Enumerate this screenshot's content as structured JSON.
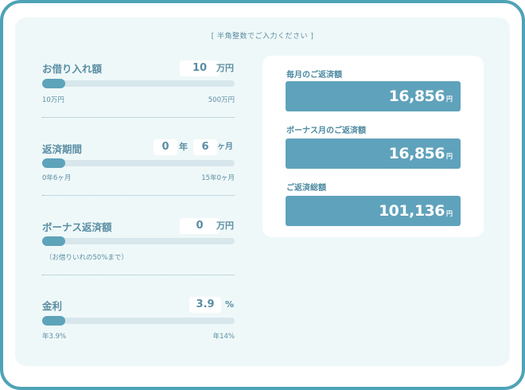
{
  "note": "[ 半角整数でご入力ください ]",
  "loan": {
    "label": "お借り入れ額",
    "value": "10",
    "unit": "万円",
    "min": "10万円",
    "max": "500万円",
    "fill": 0
  },
  "period": {
    "label": "返済期間",
    "years": "0",
    "year_unit": "年",
    "months": "6",
    "month_unit": "ヶ月",
    "min": "0年6ヶ月",
    "max": "15年0ヶ月",
    "fill": 0
  },
  "bonus": {
    "label": "ボーナス返済額",
    "value": "0",
    "unit": "万円",
    "note": "（お借りいれの50%まで）",
    "fill": 0
  },
  "rate": {
    "label": "金利",
    "value": "3.9",
    "unit": "%",
    "min": "年3.9%",
    "max": "年14%",
    "fill": 0
  },
  "results": {
    "monthly": {
      "label": "毎月のご返済額",
      "value": "16,856",
      "unit": "円"
    },
    "bonus_month": {
      "label": "ボーナス月のご返済額",
      "value": "16,856",
      "unit": "円"
    },
    "total": {
      "label": "ご返済総額",
      "value": "101,136",
      "unit": "円"
    }
  },
  "colors": {
    "frame": "#4fa3b6",
    "panel": "#eff8f9",
    "accent": "#5fa2bb",
    "text": "#5a8ea3"
  }
}
